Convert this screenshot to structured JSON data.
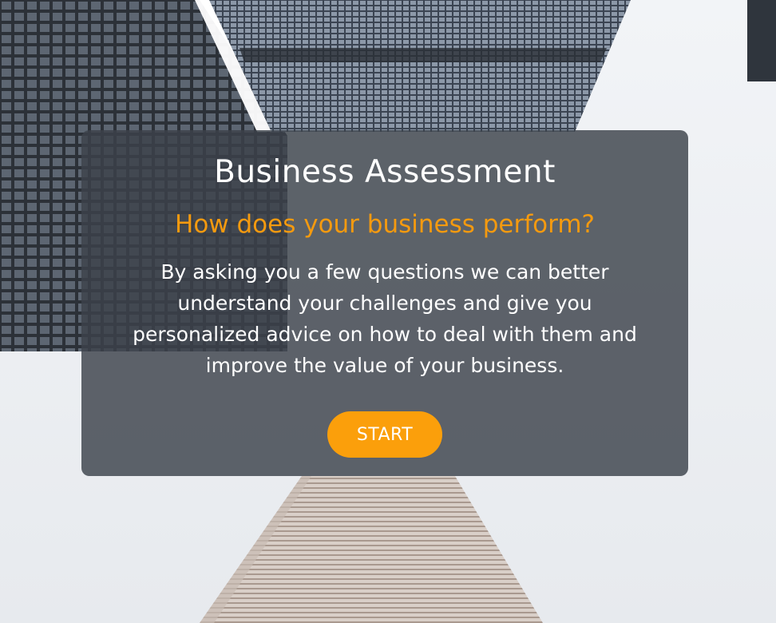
{
  "card": {
    "title": "Business Assessment",
    "subtitle": "How does your business perform?",
    "description": "By asking you a few questions we can better understand your challenges and give you personalized advice on how to deal with them and improve the value of your business.",
    "start_label": "START"
  },
  "colors": {
    "accent": "#f59a0f",
    "button": "#fb9f0b",
    "card_overlay": "#3c424a"
  }
}
